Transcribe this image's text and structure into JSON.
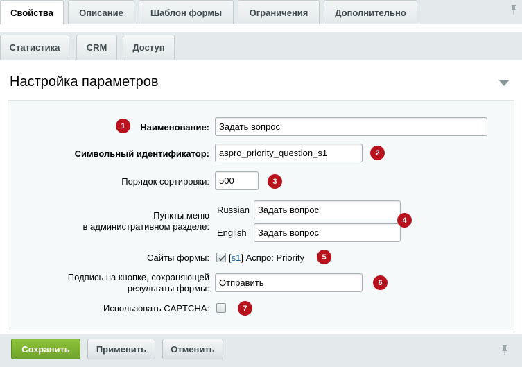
{
  "tabs_row_1": [
    "Свойства",
    "Описание",
    "Шаблон формы",
    "Ограничения",
    "Дополнительно"
  ],
  "tabs_row_2": [
    "Статистика",
    "CRM",
    "Доступ"
  ],
  "panel": {
    "title": "Настройка параметров"
  },
  "form": {
    "name": {
      "badge": "1",
      "label": "Наименование:",
      "value": "Задать вопрос"
    },
    "symbolic_id": {
      "badge": "2",
      "label": "Символьный идентификатор:",
      "value": "aspro_priority_question_s1"
    },
    "sort": {
      "badge": "3",
      "label": "Порядок сортировки:",
      "value": "500"
    },
    "menu": {
      "badge": "4",
      "label_line1": "Пункты меню",
      "label_line2": "в административном разделе:",
      "russian_label": "Russian",
      "russian_value": "Задать вопрос",
      "english_label": "English",
      "english_value": "Задать вопрос"
    },
    "sites": {
      "badge": "5",
      "label": "Сайты формы:",
      "open_bracket": "[",
      "site_link": "s1",
      "close_bracket": "]",
      "site_name": "Аспро: Priority",
      "checked": true
    },
    "button_caption": {
      "badge": "6",
      "label_line1": "Подпись на кнопке, сохраняющей",
      "label_line2": "результаты формы:",
      "value": "Отправить"
    },
    "captcha": {
      "badge": "7",
      "label": "Использовать CAPTCHA:",
      "checked": false
    }
  },
  "footer": {
    "save": "Сохранить",
    "apply": "Применить",
    "cancel": "Отменить"
  },
  "colors": {
    "badge": "#b8121c",
    "save_button": "#7cb331",
    "link": "#1b61a5",
    "background": "#e4eaec"
  }
}
